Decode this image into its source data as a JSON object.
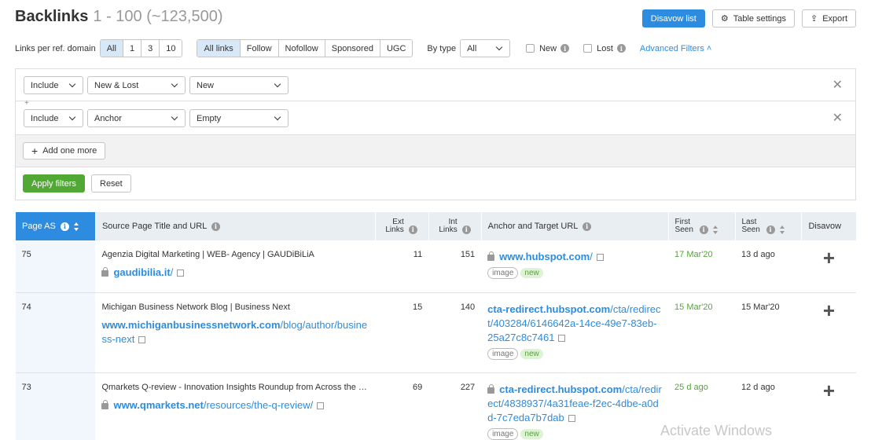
{
  "header": {
    "title": "Backlinks",
    "subtitle": "1 - 100 (~123,500)",
    "disavow_list": "Disavow list",
    "table_settings": "Table settings",
    "export": "Export"
  },
  "toolbar": {
    "links_per_domain_label": "Links per ref. domain",
    "links_per_domain": [
      "All",
      "1",
      "3",
      "10"
    ],
    "link_types": [
      "All links",
      "Follow",
      "Nofollow",
      "Sponsored",
      "UGC"
    ],
    "by_type_label": "By type",
    "by_type_value": "All",
    "new_label": "New",
    "lost_label": "Lost",
    "advanced_filters": "Advanced Filters"
  },
  "filters": {
    "rows": [
      {
        "mode": "Include",
        "field": "New & Lost",
        "value": "New"
      },
      {
        "mode": "Include",
        "field": "Anchor",
        "value": "Empty"
      }
    ],
    "add_more": "Add one more",
    "apply": "Apply filters",
    "reset": "Reset"
  },
  "table": {
    "headers": {
      "page_as": "Page AS",
      "source": "Source Page Title and URL",
      "ext_links": "Ext Links",
      "int_links": "Int Links",
      "anchor": "Anchor and Target URL",
      "first_seen": "First Seen",
      "last_seen": "Last Seen",
      "disavow": "Disavow"
    },
    "rows": [
      {
        "page_as": "75",
        "title": "Agenzia Digital Marketing | WEB- Agency | GAUDiBiLiA",
        "url_host": "gaudibilia.it",
        "url_path": "/",
        "ext": "11",
        "int": "151",
        "anchor_host": "www.hubspot.com",
        "anchor_path": "/",
        "tags": [
          "image",
          "new"
        ],
        "first_seen": "17 Mar'20",
        "last_seen": "13 d ago"
      },
      {
        "page_as": "74",
        "title": "Michigan Business Network Blog | Business Next",
        "url_host": "www.michiganbusinessnetwork.com",
        "url_path": "/blog/author/business-next",
        "ext": "15",
        "int": "140",
        "anchor_host": "cta-redirect.hubspot.com",
        "anchor_path": "/cta/redirect/403284/6146642a-14ce-49e7-83eb-25a27c8c7461",
        "tags": [
          "image",
          "new"
        ],
        "first_seen": "15 Mar'20",
        "last_seen": "15 Mar'20"
      },
      {
        "page_as": "73",
        "title": "Qmarkets Q-review - Innovation Insights Roundup from Across the …",
        "url_host": "www.qmarkets.net",
        "url_path": "/resources/the-q-review/",
        "ext": "69",
        "int": "227",
        "anchor_host": "cta-redirect.hubspot.com",
        "anchor_path": "/cta/redirect/4838937/4a31feae-f2ec-4dbe-a0dd-7c7eda7b7dab",
        "tags": [
          "image",
          "new"
        ],
        "first_seen": "25 d ago",
        "last_seen": "12 d ago"
      }
    ]
  },
  "watermark": "Activate Windows"
}
